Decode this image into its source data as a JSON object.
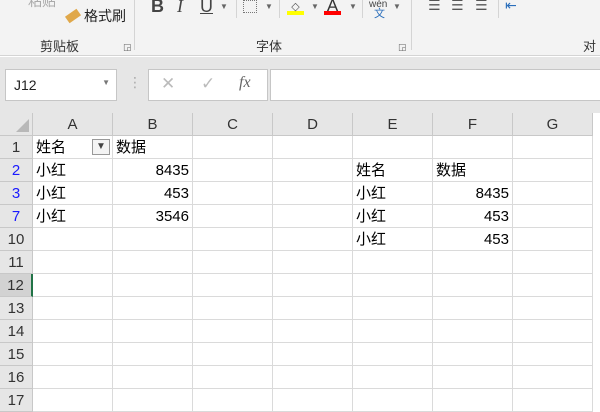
{
  "ribbon": {
    "paste": "粘贴",
    "format_painter": "格式刷",
    "clipboard_group": "剪贴板",
    "font_group": "字体",
    "align_group": "对",
    "bold": "B",
    "italic": "I",
    "underline": "U",
    "font_color_letter": "A",
    "phonetic_top": "wén",
    "phonetic_char": "文",
    "fill_color": "#ffff00",
    "font_color": "#ff0000"
  },
  "formula_bar": {
    "name_box": "J12",
    "cancel": "✕",
    "enter": "✓",
    "fx": "fx",
    "value": ""
  },
  "columns": [
    "A",
    "B",
    "C",
    "D",
    "E",
    "F",
    "G"
  ],
  "rows": [
    "1",
    "2",
    "3",
    "7",
    "10",
    "11",
    "12",
    "13",
    "14",
    "15",
    "16",
    "17"
  ],
  "cells": {
    "A1": "姓名",
    "B1": "数据",
    "A2": "小红",
    "B2": "8435",
    "A3": "小红",
    "B3": "453",
    "A7": "小红",
    "B7": "3546",
    "E2": "姓名",
    "F2": "数据",
    "E3": "小红",
    "F3": "8435",
    "E7": "小红",
    "F7": "453",
    "E10": "小红",
    "F10": "453"
  }
}
